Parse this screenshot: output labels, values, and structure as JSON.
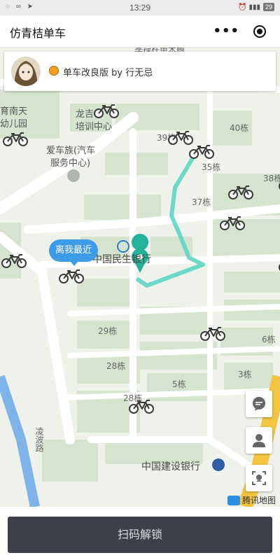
{
  "status_bar": {
    "time": "13:29",
    "left_icons": "◌ ∞ ➤",
    "right_icons": "⏰ ▮▮▮",
    "battery": "29"
  },
  "title_bar": {
    "title": "仿青桔单车",
    "more_label": "•••"
  },
  "info_card": {
    "text": "单车改良版 by 行无忌"
  },
  "map": {
    "labels": {
      "top_road": "季禄杵甲木腾",
      "kindergarten_1": "育南天",
      "kindergarten_2": "幼儿园",
      "training_1": "龙吉",
      "training_2": "培训中心",
      "car_club_1": "爱车族(汽车",
      "car_club_2": "服务中心)",
      "b39": "39栋",
      "b40": "40栋",
      "b35": "35栋",
      "b38": "38栋",
      "b37": "37栋",
      "minsheng": "中国民生银行",
      "b29": "29栋",
      "b6": "6栋",
      "b28a": "28栋",
      "b3": "3栋",
      "b5": "5栋",
      "b28b": "28栋",
      "lingbo": "凌波路",
      "ccb": "中国建设银行"
    },
    "nearest_label": "离我最近",
    "attribution": "腾讯地图",
    "route_color": "#5dd6c4",
    "marker_color": "#22b39a"
  },
  "bottom": {
    "scan_label": "扫码解锁"
  },
  "colors": {
    "map_bg": "#eef2ea",
    "block": "#d6e3cf",
    "road": "#ffffff",
    "river": "#7fb4e8",
    "highway": "#f2c440",
    "button_bg": "#3c4048",
    "bubble": "#3e9be8"
  }
}
